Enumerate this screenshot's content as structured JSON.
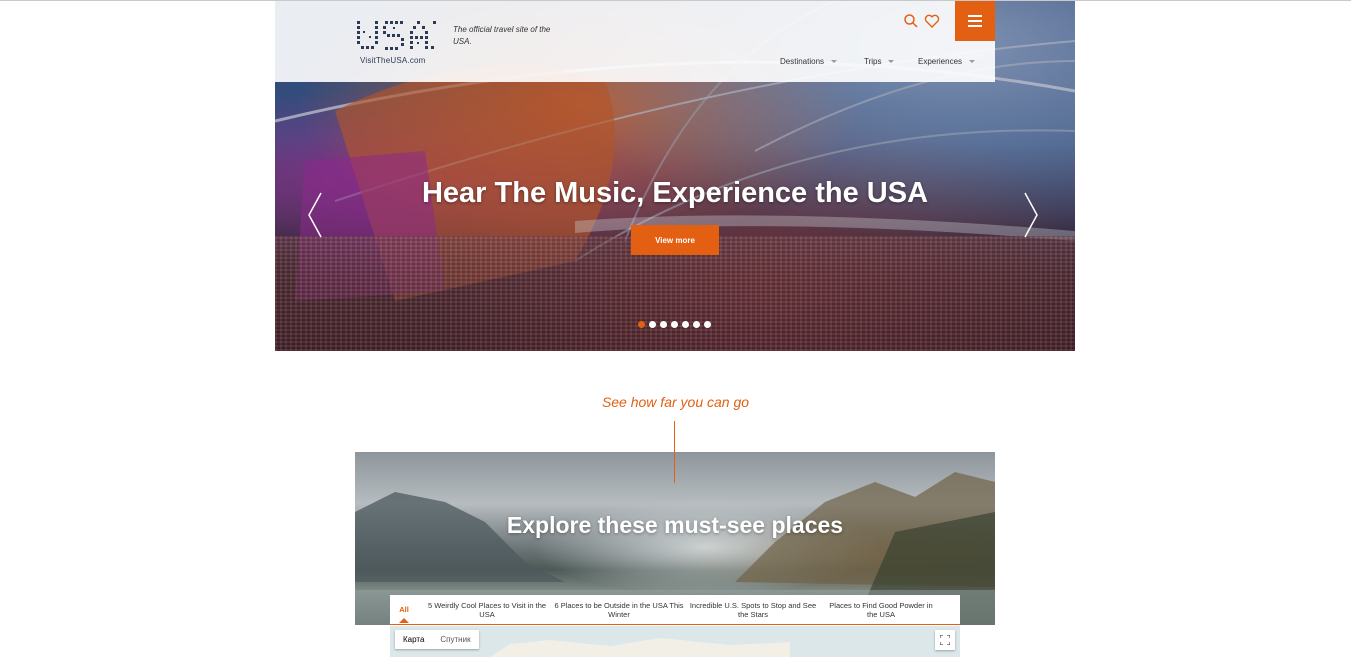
{
  "header": {
    "logo_text": "USA",
    "logo_caption": "VisitTheUSA.com",
    "tagline": "The official travel site of the USA.",
    "icons": [
      "search-icon",
      "heart-icon",
      "menu-icon"
    ],
    "nav": [
      {
        "label": "Destinations"
      },
      {
        "label": "Trips"
      },
      {
        "label": "Experiences"
      }
    ],
    "accent_color": "#e35f12"
  },
  "hero": {
    "title": "Hear The Music, Experience the USA",
    "cta_label": "View more",
    "slide_count": 7,
    "active_slide": 1
  },
  "section": {
    "tagline": "See how far you can go",
    "title": "Explore these must-see places",
    "tabs": [
      {
        "label": "All"
      },
      {
        "label": "5 Weirdly Cool Places to Visit in the USA"
      },
      {
        "label": "6 Places to be Outside in the USA This Winter"
      },
      {
        "label": "Incredible U.S. Spots to Stop and See the Stars"
      },
      {
        "label": "Places to Find Good Powder in the USA"
      }
    ]
  },
  "map": {
    "types": [
      {
        "label": "Карта"
      },
      {
        "label": "Спутник"
      }
    ],
    "selected_type": "Карта"
  }
}
